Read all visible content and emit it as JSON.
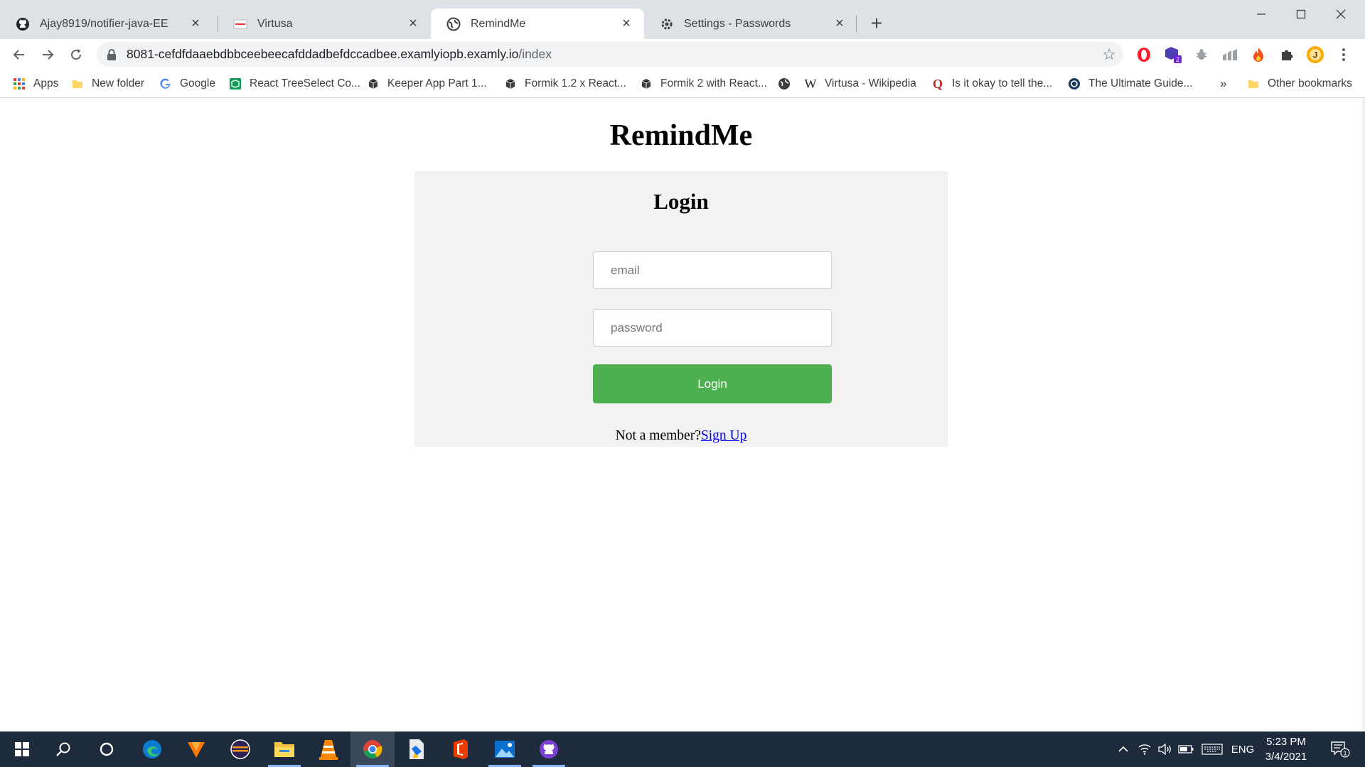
{
  "browser": {
    "tabs": [
      {
        "title": "Ajay8919/notifier-java-EE",
        "icon": "github-icon",
        "active": false
      },
      {
        "title": "Virtusa",
        "icon": "virtusa-favicon",
        "active": false
      },
      {
        "title": "RemindMe",
        "icon": "globe-icon",
        "active": true
      },
      {
        "title": "Settings - Passwords",
        "icon": "gear-icon",
        "active": false
      }
    ],
    "new_tab_glyph": "+",
    "url_host": "8081-cefdfdaaebdbbceebeecafddadbefdccadbee.examlyiopb.examly.io",
    "url_path": "/index",
    "bookmarks": [
      {
        "label": "Apps",
        "icon": "apps-grid-icon"
      },
      {
        "label": "New folder",
        "icon": "folder-icon"
      },
      {
        "label": "Google",
        "icon": "google-icon"
      },
      {
        "label": "React TreeSelect Co...",
        "icon": "codesandbox-icon"
      },
      {
        "label": "Keeper App Part 1...",
        "icon": "cube-icon"
      },
      {
        "label": "Formik 1.2 x React...",
        "icon": "cube-icon"
      },
      {
        "label": "Formik 2 with React...",
        "icon": "cube-icon"
      },
      {
        "label": "",
        "icon": "globe-icon"
      },
      {
        "label": "Virtusa - Wikipedia",
        "icon": "wikipedia-icon"
      },
      {
        "label": "Is it okay to tell the...",
        "icon": "quora-icon"
      },
      {
        "label": "The Ultimate Guide...",
        "icon": "site-icon"
      }
    ],
    "bookmarks_overflow": "»",
    "other_bookmarks": "Other bookmarks",
    "extension_badge": "2",
    "profile_initial": "J"
  },
  "page": {
    "title": "RemindMe",
    "login": {
      "heading": "Login",
      "email_placeholder": "email",
      "password_placeholder": "password",
      "button_label": "Login",
      "signup_prompt": "Not a member?",
      "signup_link": "Sign Up"
    }
  },
  "taskbar": {
    "language": "ENG",
    "time": "5:23 PM",
    "date": "3/4/2021",
    "notification_count": "1"
  },
  "colors": {
    "login_button": "#4caf50",
    "card_background": "#f1f2f1",
    "link": "#0000ee",
    "taskbar": "#1e2b3c"
  }
}
